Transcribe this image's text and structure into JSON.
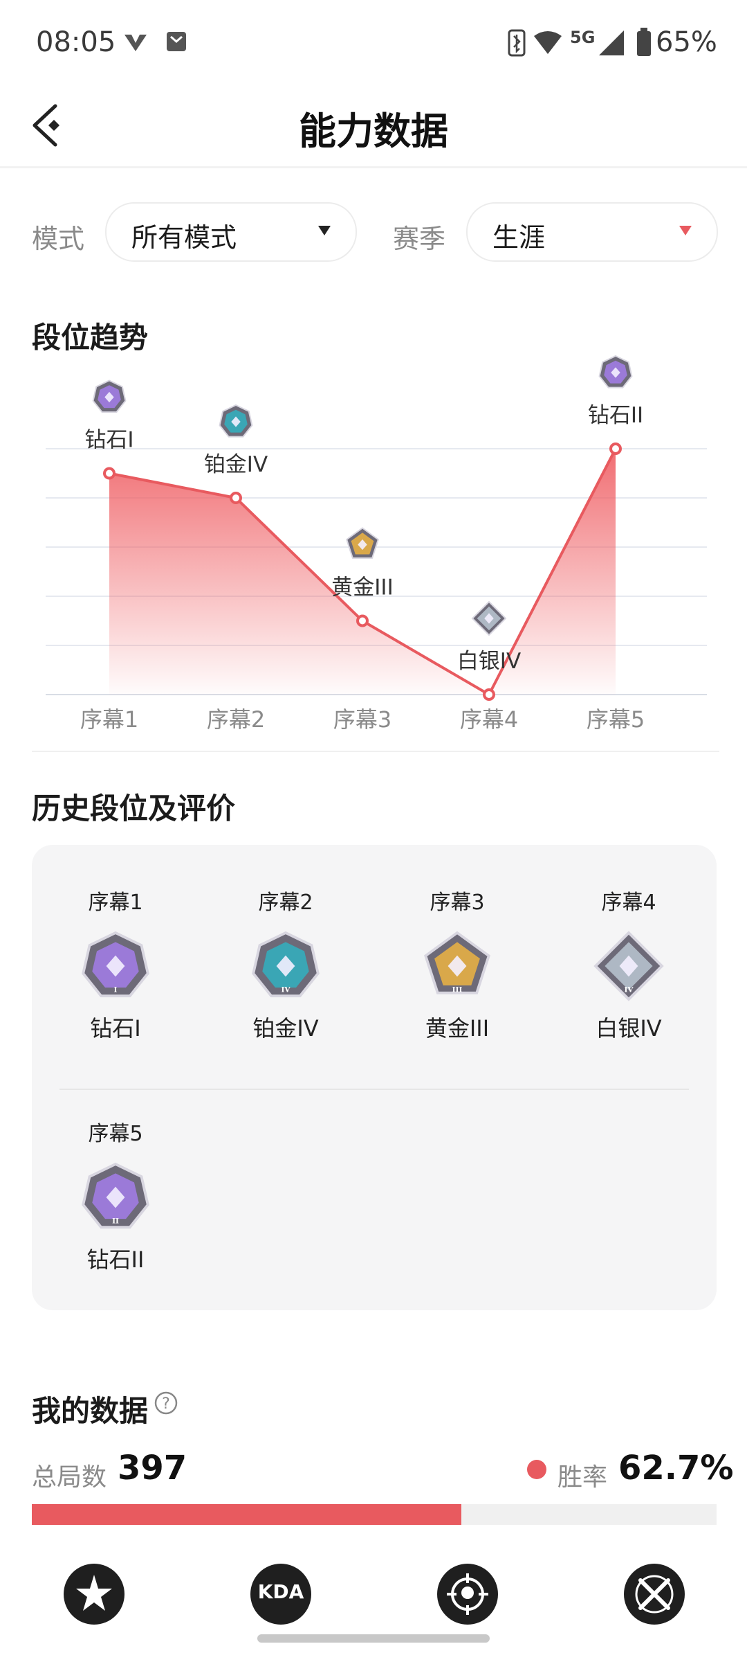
{
  "status_bar": {
    "time": "08:05",
    "network": "5G",
    "battery": "65%"
  },
  "header": {
    "title": "能力数据"
  },
  "filters": {
    "mode_label": "模式",
    "mode_value": "所有模式",
    "season_label": "赛季",
    "season_value": "生涯"
  },
  "trend": {
    "title": "段位趋势"
  },
  "chart_data": {
    "type": "area",
    "categories": [
      "序幕1",
      "序幕2",
      "序幕3",
      "序幕4",
      "序幕5"
    ],
    "rank_labels": [
      "钻石I",
      "铂金IV",
      "黄金III",
      "白银IV",
      "钻石II"
    ],
    "values": [
      4.5,
      4.0,
      1.5,
      0.0,
      5.0
    ],
    "ylim": [
      0,
      5
    ],
    "grid": true,
    "color": "#e85a5f"
  },
  "history": {
    "title": "历史段位及评价",
    "items": [
      {
        "season": "序幕1",
        "rank": "钻石I",
        "tier": "diamond",
        "numeral": "I"
      },
      {
        "season": "序幕2",
        "rank": "铂金IV",
        "tier": "platinum",
        "numeral": "IV"
      },
      {
        "season": "序幕3",
        "rank": "黄金III",
        "tier": "gold",
        "numeral": "III"
      },
      {
        "season": "序幕4",
        "rank": "白银IV",
        "tier": "silver",
        "numeral": "IV"
      },
      {
        "season": "序幕5",
        "rank": "钻石II",
        "tier": "diamond",
        "numeral": "II"
      }
    ]
  },
  "my_data": {
    "title": "我的数据",
    "total_label": "总局数",
    "total_value": "397",
    "winrate_label": "胜率",
    "winrate_value": "62.7%",
    "winrate_fraction": 0.627
  },
  "bottom_nav": {
    "kda_label": "KDA"
  },
  "colors": {
    "accent": "#e85a5f",
    "diamond": "#9b7ad8",
    "platinum": "#3aa6b5",
    "gold": "#d9a84a",
    "silver": "#aeb8c4"
  }
}
